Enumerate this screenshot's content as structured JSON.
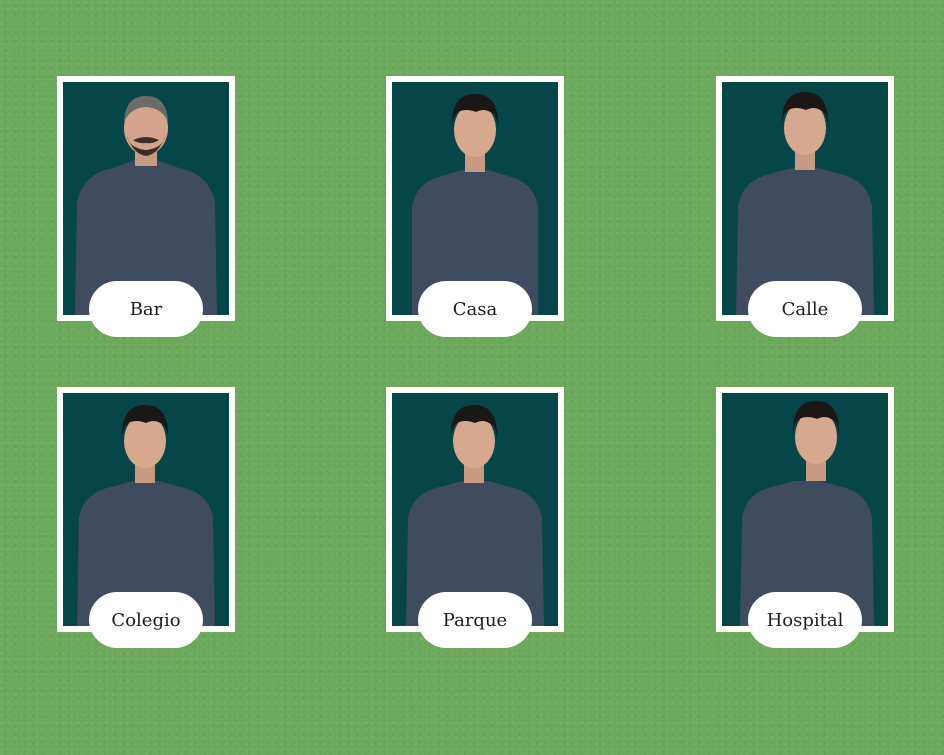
{
  "cards": [
    {
      "label": "Bar",
      "signer": "man"
    },
    {
      "label": "Casa",
      "signer": "woman"
    },
    {
      "label": "Calle",
      "signer": "woman"
    },
    {
      "label": "Colegio",
      "signer": "woman"
    },
    {
      "label": "Parque",
      "signer": "woman"
    },
    {
      "label": "Hospital",
      "signer": "woman"
    }
  ],
  "colors": {
    "background": "#6aa85a",
    "photo_background": "#064548",
    "sweater": "#3f4b5e",
    "card": "#ffffff"
  }
}
